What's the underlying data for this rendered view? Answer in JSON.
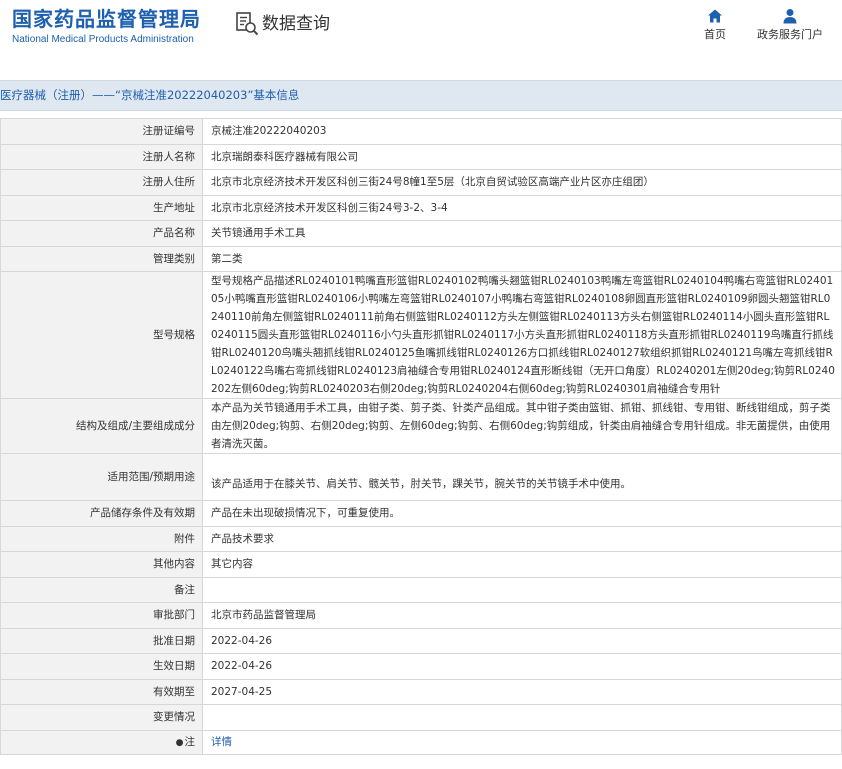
{
  "header": {
    "site_title_cn": "国家药品监督管理局",
    "site_title_en": "National Medical Products Administration",
    "module_title": "数据查询",
    "nav": [
      {
        "label": "首页",
        "icon": "home-icon"
      },
      {
        "label": "政务服务门户",
        "icon": "user-icon"
      }
    ]
  },
  "breadcrumb": "医疗器械（注册）——“京械注准20222040203”基本信息",
  "detail": {
    "rows": [
      {
        "label": "注册证编号",
        "value": "京械注准20222040203"
      },
      {
        "label": "注册人名称",
        "value": "北京瑞朗泰科医疗器械有限公司"
      },
      {
        "label": "注册人住所",
        "value": "北京市北京经济技术开发区科创三街24号8幢1至5层（北京自贸试验区高端产业片区亦庄组团）"
      },
      {
        "label": "生产地址",
        "value": "北京市北京经济技术开发区科创三街24号3-2、3-4"
      },
      {
        "label": "产品名称",
        "value": "关节镜通用手术工具"
      },
      {
        "label": "管理类别",
        "value": "第二类"
      },
      {
        "label": "型号规格",
        "value": "型号规格产品描述RL0240101鸭嘴直形篮钳RL0240102鸭嘴头翘篮钳RL0240103鸭嘴左弯篮钳RL0240104鸭嘴右弯篮钳RL0240105小鸭嘴直形篮钳RL0240106小鸭嘴左弯篮钳RL0240107小鸭嘴右弯篮钳RL0240108卵圆直形篮钳RL0240109卵圆头翘篮钳RL0240110前角左侧篮钳RL0240111前角右侧篮钳RL0240112方头左侧篮钳RL0240113方头右侧篮钳RL0240114小圆头直形篮钳RL0240115圆头直形篮钳RL0240116小勺头直形抓钳RL0240117小方头直形抓钳RL0240118方头直形抓钳RL0240119鸟嘴直行抓线钳RL0240120鸟嘴头翘抓线钳RL0240125鱼嘴抓线钳RL0240126方口抓线钳RL0240127软组织抓钳RL0240121鸟嘴左弯抓线钳RL0240122鸟嘴右弯抓线钳RL0240123肩袖缝合专用钳RL0240124直形断线钳（无开口角度）RL0240201左侧20deg;钩剪RL0240202左侧60deg;钩剪RL0240203右侧20deg;钩剪RL0240204右侧60deg;钩剪RL0240301肩袖缝合专用针"
      },
      {
        "label": "结构及组成/主要组成成分",
        "value": "本产品为关节镜通用手术工具，由钳子类、剪子类、针类产品组成。其中钳子类由篮钳、抓钳、抓线钳、专用钳、断线钳组成，剪子类由左侧20deg;钩剪、右侧20deg;钩剪、左侧60deg;钩剪、右侧60deg;钩剪组成，针类由肩袖缝合专用针组成。非无菌提供，由使用者清洗灭菌。"
      },
      {
        "label": "适用范围/预期用途",
        "value": "该产品适用于在膝关节、肩关节、髋关节，肘关节，踝关节，腕关节的关节镜手术中使用。"
      },
      {
        "label": "产品储存条件及有效期",
        "value": "产品在未出现破损情况下，可重复使用。"
      },
      {
        "label": "附件",
        "value": "产品技术要求"
      },
      {
        "label": "其他内容",
        "value": "其它内容"
      },
      {
        "label": "备注",
        "value": ""
      },
      {
        "label": "审批部门",
        "value": "北京市药品监督管理局"
      },
      {
        "label": "批准日期",
        "value": "2022-04-26"
      },
      {
        "label": "生效日期",
        "value": "2022-04-26"
      },
      {
        "label": "有效期至",
        "value": "2027-04-25"
      },
      {
        "label": "变更情况",
        "value": ""
      }
    ],
    "note_label": "注",
    "note_link": "详情"
  },
  "colors": {
    "brand_blue": "#1e5fae",
    "breadcrumb_bg": "#dfe8f0",
    "label_bg": "#f2f2f2",
    "border": "#d7d7d7"
  }
}
